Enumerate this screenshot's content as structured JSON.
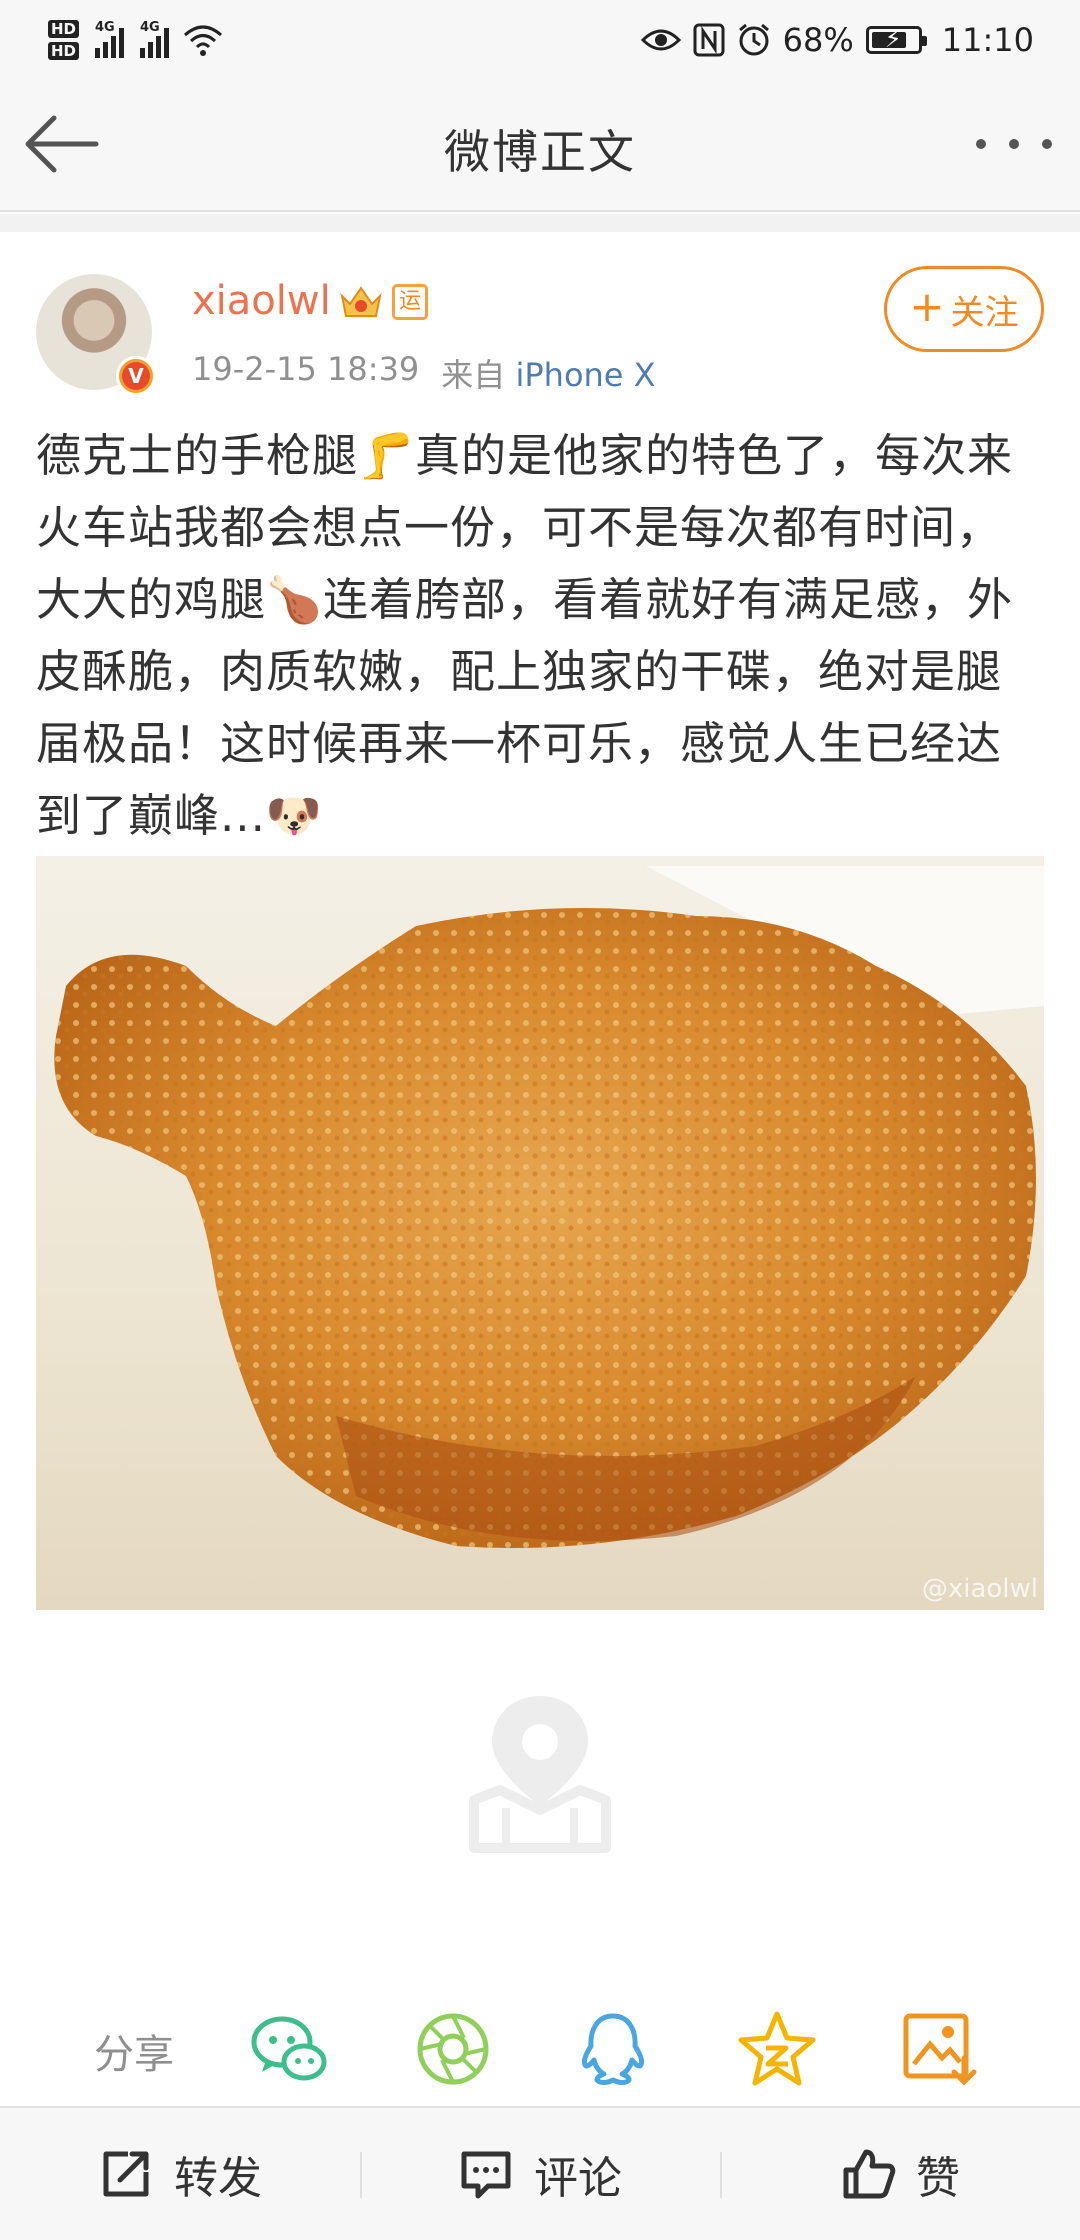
{
  "status_bar": {
    "hd1": "HD",
    "hd2": "HD",
    "signal1": "4G",
    "signal2": "4G",
    "battery": "68%",
    "time": "11:10",
    "battery_level_percent": 68
  },
  "nav": {
    "title": "微博正文"
  },
  "post": {
    "username": "xiaolwl",
    "badge_text": "运",
    "time": "19-2-15 18:39",
    "from_label": "来自",
    "source": "iPhone X",
    "follow_label": "关注",
    "follow_plus": "+",
    "avatar_badge": "V",
    "text_p1": "德克士的手枪腿",
    "emoji_leg": "🦵",
    "text_p2": "真的是他家的特色了，每次来火车站我都会想点一份，可不是每次都有时间，大大的鸡腿",
    "emoji_drumstick": "🍗",
    "text_p3": "连着胯部，看着就好有满足感，外皮酥脆，肉质软嫩，配上独家的干碟，绝对是腿届极品！这时候再来一杯可乐，感觉人生已经达到了巅峰...",
    "emoji_doge": "🐶",
    "photo_watermark": "@xiaolwl"
  },
  "share": {
    "label": "分享",
    "icons": [
      "wechat-icon",
      "moments-icon",
      "qq-icon",
      "qzone-icon",
      "save-image-icon"
    ]
  },
  "bottom_bar": {
    "repost": "转发",
    "comment": "评论",
    "like": "赞"
  },
  "colors": {
    "accent_orange": "#f08a24",
    "username": "#eb7350",
    "source_link": "#507daf",
    "wechat_green": "#3cbf8c",
    "qq_blue": "#4aa6e0",
    "qzone_yellow": "#f4b400"
  }
}
